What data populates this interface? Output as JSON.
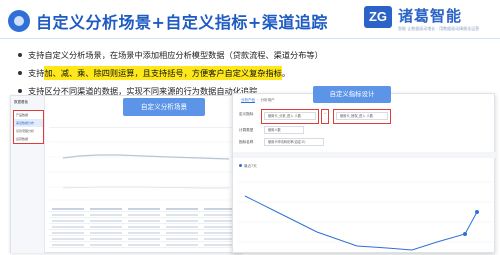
{
  "header": {
    "title": "自定义分析场景+自定义指标+渠道追踪",
    "logo_mark": "ZG",
    "logo_text": "诸葛智能",
    "logo_subtitle": "智能 让数据驱动增长 · 用数据驱动精细化运营"
  },
  "bullets": [
    {
      "text": "支持自定义分析场景，在场景中添加相应分析模型数据（贷款流程、渠道分布等）",
      "highlight": ""
    },
    {
      "text_before": "支持",
      "highlight": "加、减、乘、除四则运算，且支持括号，方便客户自定义复杂指标",
      "text_after": "。"
    },
    {
      "text": "支持区分不同渠道的数据，实现不同来源的行为数据自动化追踪",
      "highlight": ""
    }
  ],
  "left_screenshot": {
    "badge": "自定义分析场景",
    "sidebar_title": "数据看板",
    "sidebar_items": [
      "产品数据",
      "渠道数据分布",
      "贷款流程分析",
      "运营数据"
    ]
  },
  "right_screenshot": {
    "badge": "自定义指标设计",
    "tabs": [
      "分析产品",
      "分析用户"
    ],
    "form": {
      "label_formula": "定义指标",
      "field_a": "使用卡_分析_进入 人数",
      "field_b": "使用卡_授权_进入 人数",
      "operator": "÷",
      "label_type": "计算类型",
      "type_value": "使用人数",
      "label_name": "指标名称",
      "name_value": "使用卡申请转化率(自定义)"
    },
    "chart_toolbar": "最近7天"
  },
  "colors": {
    "brand_blue": "#1e5bc2",
    "badge_blue": "#5c95e8",
    "highlight_yellow": "#ffe81a",
    "annotation_red": "#e23b3b"
  }
}
